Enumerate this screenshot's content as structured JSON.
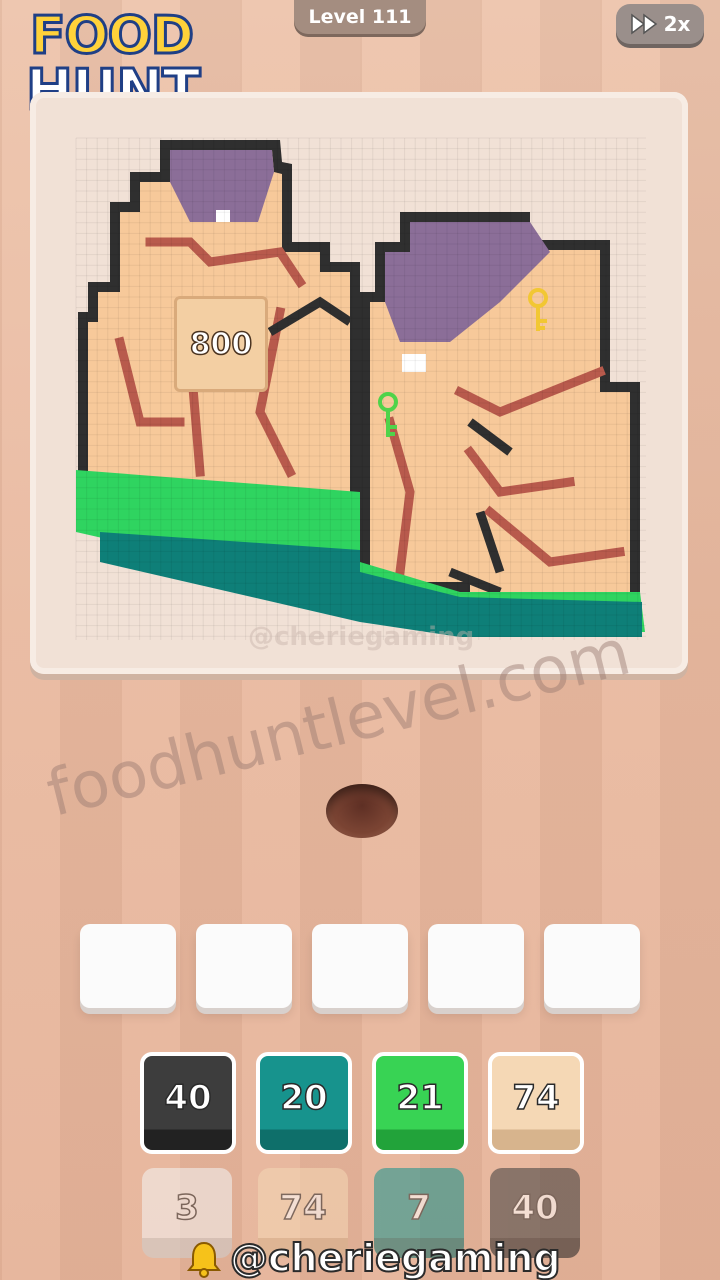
{
  "logo": {
    "line1": "FOOD",
    "line2": "HUNT"
  },
  "header": {
    "level_label": "Level 111",
    "speed_label": "2x",
    "speed_icon": "fast-forward-icon"
  },
  "board": {
    "watermark": "@cheriegaming",
    "score_tile": "800",
    "keys": [
      {
        "icon": "key-icon",
        "color": "#f2c733"
      },
      {
        "icon": "key-icon",
        "color": "#4fd34a"
      }
    ]
  },
  "site_watermark": "foodhuntlevel.com",
  "slots": [
    "",
    "",
    "",
    "",
    ""
  ],
  "blocks_row1": [
    {
      "value": "40",
      "color": "#3d3d3d",
      "shade": "#222222"
    },
    {
      "value": "20",
      "color": "#17938d",
      "shade": "#0e6f6a"
    },
    {
      "value": "21",
      "color": "#38d354",
      "shade": "#22a33a"
    },
    {
      "value": "74",
      "color": "#f5d8b5",
      "shade": "#d7b48d"
    }
  ],
  "blocks_row2": [
    {
      "value": "3",
      "color": "#f4f4f4",
      "shade": "#cfcfcf"
    },
    {
      "value": "74",
      "color": "#f5d8b5",
      "shade": "#d7b48d"
    },
    {
      "value": "7",
      "color": "#17938d",
      "shade": "#0e6f6a"
    },
    {
      "value": "40",
      "color": "#3d3d3d",
      "shade": "#222222"
    }
  ],
  "footer": {
    "handle": "@cheriegaming",
    "bell_icon": "bell-icon"
  },
  "colors": {
    "board_bg": "#f1e1d6",
    "skin": "#f7c99a",
    "outline": "#2f2f2f",
    "brown": "#b85a4c",
    "purple": "#8b6e98",
    "grass": "#2fd460",
    "teal": "#0e7f78"
  }
}
